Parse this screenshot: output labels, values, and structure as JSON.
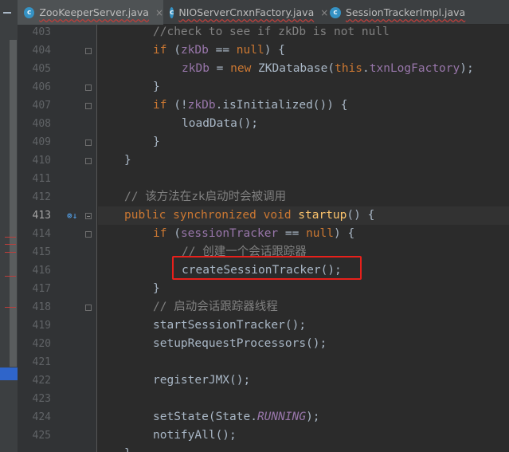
{
  "tabs": [
    {
      "label": "ZooKeeperServer.java",
      "icon": "class-icon",
      "active": true
    },
    {
      "label": "NIOServerCnxnFactory.java",
      "icon": "class-icon",
      "active": false
    },
    {
      "label": "SessionTrackerImpl.java",
      "icon": "class-icon",
      "active": false
    }
  ],
  "tab_icon_letter": "c",
  "close_glyph": "×",
  "gutter": {
    "line_numbers": [
      "403",
      "404",
      "405",
      "406",
      "407",
      "408",
      "409",
      "410",
      "411",
      "412",
      "413",
      "414",
      "415",
      "416",
      "417",
      "418",
      "419",
      "420",
      "421",
      "422",
      "423",
      "424",
      "425"
    ],
    "current_line": "413",
    "override_icon": "⊚↓"
  },
  "code": {
    "l403": "//check to see if zkDb is not null",
    "l404_kw": "if",
    "l404_a": " (",
    "l404_fld": "zkDb",
    "l404_b": " == ",
    "l404_null": "null",
    "l404_c": ") {",
    "l405_fld": "zkDb",
    "l405_a": " = ",
    "l405_new": "new",
    "l405_b": " ZKDatabase(",
    "l405_this": "this",
    "l405_c": ".",
    "l405_fld2": "txnLogFactory",
    "l405_d": ");",
    "l406": "}",
    "l407_kw": "if",
    "l407_a": " (!",
    "l407_fld": "zkDb",
    "l407_b": ".isInitialized()) {",
    "l408": "loadData();",
    "l409": "}",
    "l410": "}",
    "l412": "// 该方法在zk启动时会被调用",
    "l413_public": "public",
    "l413_sync": "synchronized",
    "l413_void": "void",
    "l413_fn": "startup",
    "l413_rest": "() {",
    "l414_kw": "if",
    "l414_a": " (",
    "l414_fld": "sessionTracker",
    "l414_b": " == ",
    "l414_null": "null",
    "l414_c": ") {",
    "l415": "// 创建一个会话跟踪器",
    "l416": "createSessionTracker();",
    "l417": "}",
    "l418": "// 启动会话跟踪器线程",
    "l419": "startSessionTracker();",
    "l420": "setupRequestProcessors();",
    "l422": "registerJMX();",
    "l424_a": "setState(State.",
    "l424_cst": "RUNNING",
    "l424_b": ");",
    "l425": "notifyAll();",
    "l426": "}"
  },
  "colors": {
    "keyword": "#cc7832",
    "field": "#9876aa",
    "method_decl": "#ffc66d",
    "comment": "#808080",
    "highlight_box": "#e8201b"
  }
}
